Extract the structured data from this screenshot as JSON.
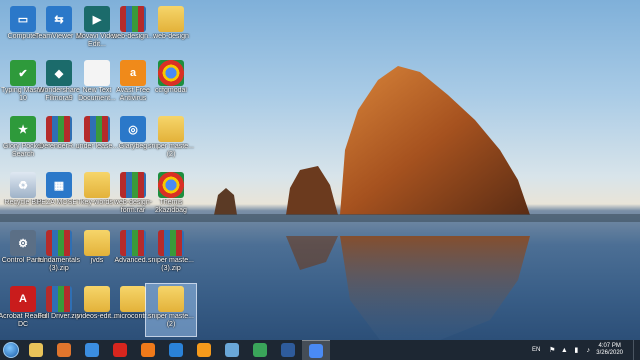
{
  "desktop": {
    "icons": [
      {
        "label": "Computer",
        "glyph": "▭",
        "cls": "g-blue"
      },
      {
        "label": "TeamViewer 15",
        "glyph": "⇆",
        "cls": "g-blue"
      },
      {
        "label": "Movavi Video Edit...",
        "glyph": "▶",
        "cls": "g-teal"
      },
      {
        "label": "web-design...",
        "glyph": "",
        "cls": "g-rar"
      },
      {
        "label": "web-design",
        "glyph": "",
        "cls": "g-folder"
      },
      {
        "label": "Typing Master 10",
        "glyph": "✔",
        "cls": "g-green"
      },
      {
        "label": "Wondershare Filmora9",
        "glyph": "◆",
        "cls": "g-teal"
      },
      {
        "label": "New Text Document...",
        "glyph": "",
        "cls": "g-file"
      },
      {
        "label": "Avast Free Antivirus",
        "glyph": "a",
        "cls": "g-orange"
      },
      {
        "label": "ccfgmodal",
        "glyph": "",
        "cls": "g-chrome"
      },
      {
        "label": "Glory Pocket Search",
        "glyph": "★",
        "cls": "g-green"
      },
      {
        "label": "DefenderR...",
        "glyph": "",
        "cls": "g-rar"
      },
      {
        "label": "under lease...",
        "glyph": "",
        "cls": "g-rar"
      },
      {
        "label": "Glarybeg",
        "glyph": "◎",
        "cls": "g-blue"
      },
      {
        "label": "sniper maste... (2)",
        "glyph": "",
        "cls": "g-folder"
      },
      {
        "label": "Recycle Bin",
        "glyph": "♻",
        "cls": "g-bin"
      },
      {
        "label": "PEZA MOSET",
        "glyph": "▦",
        "cls": "g-blue"
      },
      {
        "label": "key-words",
        "glyph": "",
        "cls": "g-folder"
      },
      {
        "label": "web-design-form.rar",
        "glyph": "",
        "cls": "g-rar"
      },
      {
        "label": "Themis 2kazidbag",
        "glyph": "",
        "cls": "g-chrome"
      },
      {
        "label": "Control Panel",
        "glyph": "⚙",
        "cls": "g-grey"
      },
      {
        "label": "fundamentals (3).zip",
        "glyph": "",
        "cls": "g-rar"
      },
      {
        "label": "jvds",
        "glyph": "",
        "cls": "g-folder"
      },
      {
        "label": "Advanced...",
        "glyph": "",
        "cls": "g-rar"
      },
      {
        "label": "sniper maste... (3).zip",
        "glyph": "",
        "cls": "g-rar"
      },
      {
        "label": "Acrobat Reader DC",
        "glyph": "A",
        "cls": "g-pdf"
      },
      {
        "label": "Full Driver.zip",
        "glyph": "",
        "cls": "g-rar"
      },
      {
        "label": "videos-edit...",
        "glyph": "",
        "cls": "g-folder"
      },
      {
        "label": "microcontr...",
        "glyph": "",
        "cls": "g-folder"
      },
      {
        "label": "sniper maste... (2)",
        "glyph": "",
        "cls": "g-folder"
      }
    ]
  },
  "taskbar": {
    "apps": [
      {
        "name": "explorer",
        "color": "#e8c35a"
      },
      {
        "name": "media-player",
        "color": "#e0752d"
      },
      {
        "name": "internet-explorer",
        "color": "#3b8de0"
      },
      {
        "name": "opera",
        "color": "#d8261e"
      },
      {
        "name": "firefox",
        "color": "#f07a1a"
      },
      {
        "name": "teamviewer",
        "color": "#2a82d8"
      },
      {
        "name": "sublime",
        "color": "#f59a1c"
      },
      {
        "name": "box",
        "color": "#6aa7d8"
      },
      {
        "name": "chrome",
        "color": "#3aa55a"
      },
      {
        "name": "photoshop",
        "color": "#2e5b9c"
      },
      {
        "name": "chrome-active",
        "color": "#4a8af4"
      }
    ],
    "language": "EN",
    "time": "4:07 PM",
    "date": "3/26/2020"
  }
}
